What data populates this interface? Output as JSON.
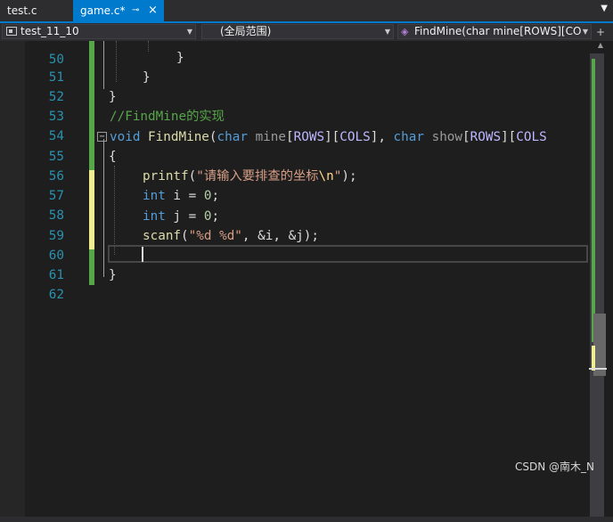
{
  "tabs": [
    {
      "label": "test.c"
    },
    {
      "label": "game.c*",
      "pin": "⊸",
      "close": "×"
    }
  ],
  "tab_overflow": "▼",
  "navbar": {
    "project": "test_11_10",
    "scope": "(全局范围)",
    "function": "FindMine(char mine[ROWS][CO",
    "split_glyph": "+"
  },
  "code_lines": [
    {
      "num": "50",
      "text": ""
    },
    {
      "num": "51",
      "text": "}"
    },
    {
      "num": "52",
      "text": "}"
    },
    {
      "num": "53",
      "text": "}"
    },
    {
      "num": "54",
      "text": "//FindMine的实现"
    },
    {
      "num": "55",
      "text": "void FindMine(char mine[ROWS][COLS], char show[ROWS][COLS]"
    },
    {
      "num": "56",
      "text": "{"
    },
    {
      "num": "57",
      "text": "printf(\"请输入要排查的坐标\\n\");"
    },
    {
      "num": "58",
      "text": "int i = 0;"
    },
    {
      "num": "59",
      "text": "int j = 0;"
    },
    {
      "num": "60",
      "text": "scanf(\"%d %d\", &i, &j);"
    },
    {
      "num": "61",
      "text": ""
    },
    {
      "num": "62",
      "text": "}"
    }
  ],
  "code_tokens": {
    "l55_void": "void",
    "l55_fn": "FindMine",
    "l55_p1": "(",
    "l55_char1": "char",
    "l55_mine": "mine",
    "l55_b1": "[",
    "l55_rows1": "ROWS",
    "l55_b2": "][",
    "l55_cols1": "COLS",
    "l55_b3": "], ",
    "l55_char2": "char",
    "l55_show": "show",
    "l55_b4": "[",
    "l55_rows2": "ROWS",
    "l55_b5": "][",
    "l55_cols2": "COLS",
    "l57_fn": "printf",
    "l57_p": "(",
    "l57_str": "\"请输入要排查的坐标",
    "l57_esc": "\\n",
    "l57_strend": "\"",
    "l57_end": ");",
    "l58_kw": "int",
    "l58_rest": " i = ",
    "l58_num": "0",
    "l58_end": ";",
    "l59_kw": "int",
    "l59_rest": " j = ",
    "l59_num": "0",
    "l59_end": ";",
    "l60_fn": "scanf",
    "l60_p": "(",
    "l60_str": "\"%d %d\"",
    "l60_rest": ", &i, &j);",
    "collapse": "−"
  },
  "watermark": "CSDN @南木_N",
  "colors": {
    "accent": "#007acc",
    "keyword": "#569cd6",
    "function": "#dcdcaa",
    "string": "#d69d85",
    "comment": "#57a64a",
    "macro": "#beb7ff",
    "line_number": "#2b91af",
    "change_saved": "#57a64a",
    "change_unsaved": "#efef91"
  }
}
